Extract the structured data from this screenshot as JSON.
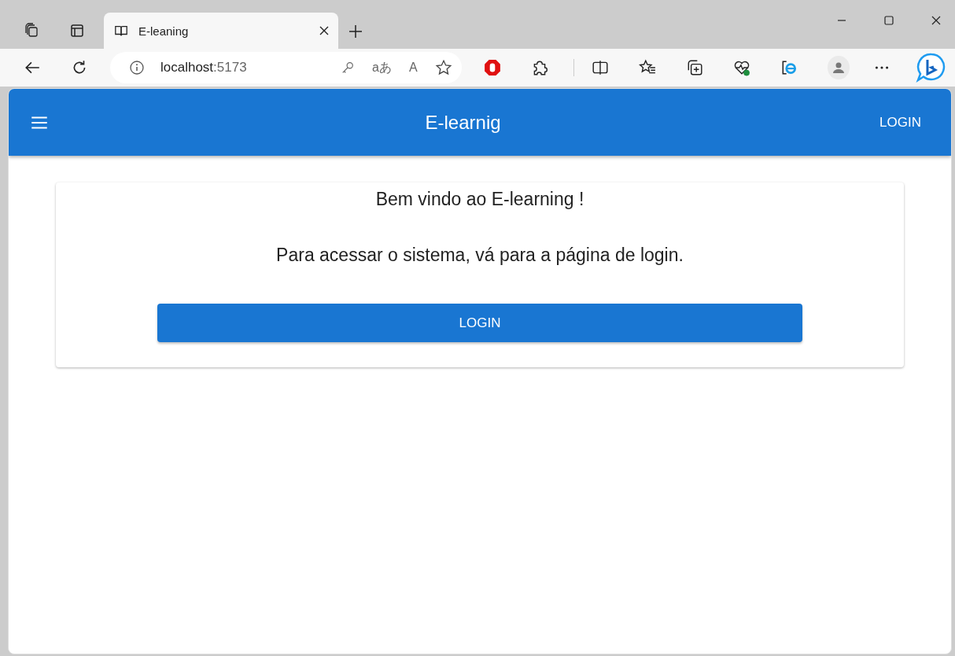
{
  "browser": {
    "tab": {
      "title": "E-leaning",
      "selected": true
    },
    "address": {
      "host": "localhost",
      "port": ":5173"
    },
    "translate_glyph": "aあ",
    "read_aloud_glyph": "A"
  },
  "app_bar": {
    "title": "E-learnig",
    "login": "LOGIN"
  },
  "card": {
    "heading": "Bem vindo ao E-learning !",
    "message": "Para acessar o sistema, vá para a página de login.",
    "button": "LOGIN"
  }
}
